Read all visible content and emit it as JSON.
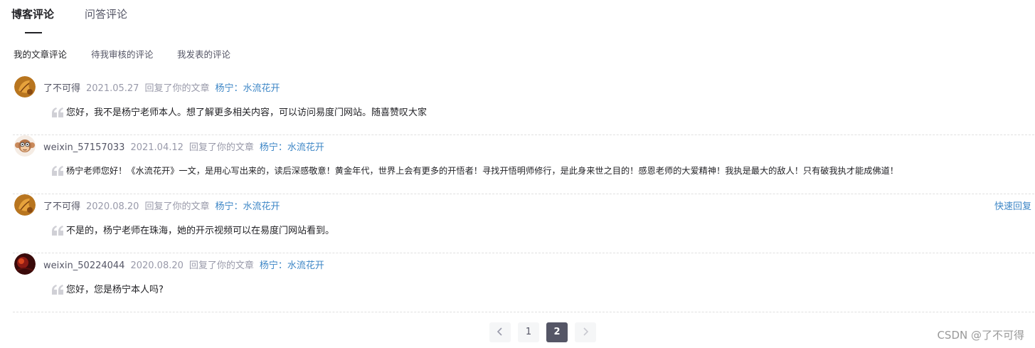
{
  "tabs": {
    "active": "博客评论",
    "other": "问答评论"
  },
  "subtabs": [
    "我的文章评论",
    "待我审核的评论",
    "我发表的评论"
  ],
  "comments": [
    {
      "username": "了不可得",
      "date": "2021.05.27",
      "action": "回复了你的文章",
      "article": "杨宁：水流花开",
      "content": "您好，我不是杨宁老师本人。想了解更多相关内容，可以访问易度门网站。随喜赞叹大家",
      "avatar_icon": "autumn-leaf-avatar"
    },
    {
      "username": "weixin_57157033",
      "date": "2021.04.12",
      "action": "回复了你的文章",
      "article": "杨宁：水流花开",
      "content": "杨宁老师您好！《水流花开》一文，是用心写出来的，读后深感敬意！黄金年代，世界上会有更多的开悟者！寻找开悟明师修行，是此身来世之目的！感恩老师的大爱精神！我执是最大的敌人！只有破我执才能成佛道！",
      "avatar_icon": "monkey-avatar"
    },
    {
      "username": "了不可得",
      "date": "2020.08.20",
      "action": "回复了你的文章",
      "article": "杨宁：水流花开",
      "content": "不是的，杨宁老师在珠海，她的开示视频可以在易度门网站看到。",
      "quick_reply": "快速回复",
      "avatar_icon": "autumn-leaf-avatar"
    },
    {
      "username": "weixin_50224044",
      "date": "2020.08.20",
      "action": "回复了你的文章",
      "article": "杨宁：水流花开",
      "content": "您好，您是杨宁本人吗?",
      "avatar_icon": "dark-red-avatar"
    }
  ],
  "pagination": {
    "pages": [
      "1",
      "2"
    ],
    "current": "2",
    "prev_icon": "chevron-left-icon",
    "next_icon": "chevron-right-icon"
  },
  "watermark": "CSDN @了不可得",
  "colors": {
    "link": "#3d86c6",
    "primary_text": "#222226",
    "secondary_text": "#555666",
    "muted_text": "#999aaa",
    "current_page_bg": "#555666"
  }
}
